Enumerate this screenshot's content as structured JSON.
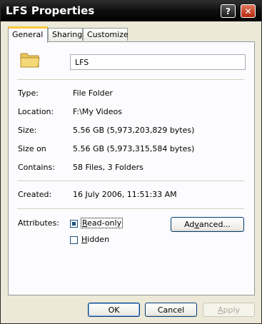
{
  "window": {
    "title": "LFS Properties"
  },
  "titlebar": {
    "help_label": "?",
    "close_label": "✕"
  },
  "tabs": [
    {
      "label": "General",
      "active": true
    },
    {
      "label": "Sharing",
      "active": false
    },
    {
      "label": "Customize",
      "active": false
    }
  ],
  "general": {
    "folder_name": "LFS",
    "fields": [
      {
        "label": "Type:",
        "value": "File Folder"
      },
      {
        "label": "Location:",
        "value": "F:\\My Videos"
      },
      {
        "label": "Size:",
        "value": "5.56 GB (5,973,203,829 bytes)"
      },
      {
        "label": "Size on",
        "value": "5.56 GB (5,973,315,584 bytes)"
      },
      {
        "label": "Contains:",
        "value": "58 Files, 3 Folders"
      }
    ],
    "created_label": "Created:",
    "created_value": "16 July 2006, 11:51:33 AM",
    "attributes_label": "Attributes:",
    "readonly": {
      "label_prefix": "",
      "mnemonic": "R",
      "label_rest": "ead-only",
      "checked": true
    },
    "hidden": {
      "mnemonic": "H",
      "label_rest": "idden",
      "checked": false
    },
    "advanced": {
      "prefix": "Ad",
      "mnemonic": "v",
      "rest": "anced..."
    }
  },
  "footer": {
    "ok_label": "OK",
    "cancel_label": "Cancel",
    "apply_prefix": "",
    "apply_mnemonic": "A",
    "apply_rest": "pply"
  }
}
